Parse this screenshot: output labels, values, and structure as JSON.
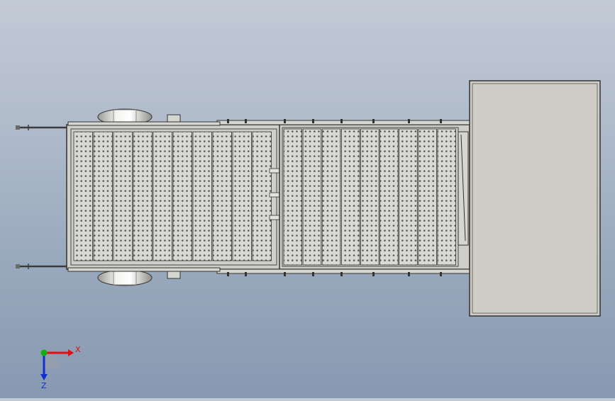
{
  "viewport": {
    "background_top": "#c3cad6",
    "background_bottom": "#8799b1"
  },
  "model": {
    "frame_color": "#d6d6d0",
    "frame_dark": "#3c3c3c",
    "panel_color": "#d9d9d4",
    "hole_color": "#55585b",
    "tire_color": "#e4e4e0",
    "cabin_color": "#cfcdc5"
  },
  "triad": {
    "x_label": "X",
    "z_label": "Z",
    "x_color": "#e01010",
    "y_color": "#10b010",
    "z_color": "#1030d0"
  }
}
